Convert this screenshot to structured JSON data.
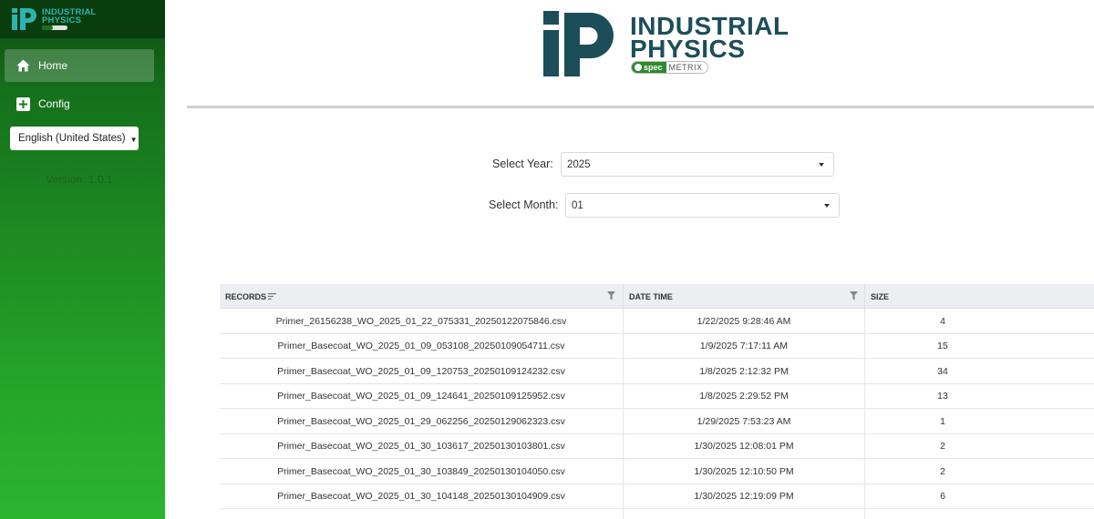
{
  "sidebar": {
    "brand": {
      "line1": "INDUSTRIAL",
      "line2": "PHYSICS"
    },
    "nav": [
      {
        "label": "Home",
        "icon": "home-icon"
      },
      {
        "label": "Config",
        "icon": "plus-icon"
      }
    ],
    "language": "English (United States)",
    "version": "Version: 1.0.1"
  },
  "header": {
    "logo": {
      "line1": "INDUSTRIAL",
      "line2": "PHYSICS",
      "badge_spec": "spec",
      "badge_metrix": "METRIX"
    }
  },
  "filters": {
    "year_label": "Select Year:",
    "year_value": "2025",
    "month_label": "Select Month:",
    "month_value": "01"
  },
  "grid": {
    "columns": [
      "RECORDS",
      "DATE TIME",
      "SIZE"
    ],
    "rows": [
      {
        "record": "Primer_26156238_WO_2025_01_22_075331_20250122075846.csv",
        "datetime": "1/22/2025 9:28:46 AM",
        "size": "4"
      },
      {
        "record": "Primer_Basecoat_WO_2025_01_09_053108_20250109054711.csv",
        "datetime": "1/9/2025 7:17:11 AM",
        "size": "15"
      },
      {
        "record": "Primer_Basecoat_WO_2025_01_09_120753_20250109124232.csv",
        "datetime": "1/8/2025 2:12:32 PM",
        "size": "34"
      },
      {
        "record": "Primer_Basecoat_WO_2025_01_09_124641_20250109125952.csv",
        "datetime": "1/8/2025 2:29:52 PM",
        "size": "13"
      },
      {
        "record": "Primer_Basecoat_WO_2025_01_29_062256_20250129062323.csv",
        "datetime": "1/29/2025 7:53:23 AM",
        "size": "1"
      },
      {
        "record": "Primer_Basecoat_WO_2025_01_30_103617_20250130103801.csv",
        "datetime": "1/30/2025 12:08:01 PM",
        "size": "2"
      },
      {
        "record": "Primer_Basecoat_WO_2025_01_30_103849_20250130104050.csv",
        "datetime": "1/30/2025 12:10:50 PM",
        "size": "2"
      },
      {
        "record": "Primer_Basecoat_WO_2025_01_30_104148_20250130104909.csv",
        "datetime": "1/30/2025 12:19:09 PM",
        "size": "6"
      }
    ]
  }
}
